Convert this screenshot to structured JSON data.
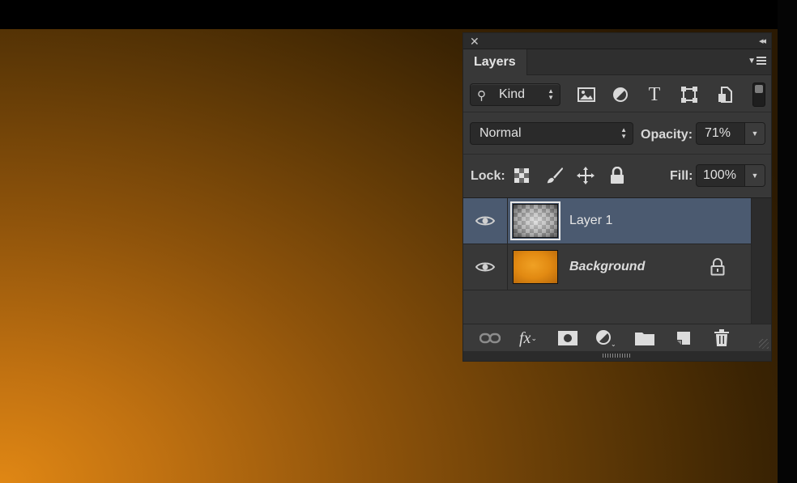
{
  "panel": {
    "close_glyph": "✕",
    "collapse_glyph": "◂◂",
    "tab_label": "Layers",
    "filter": {
      "kind_label": "Kind"
    },
    "blend_mode": "Normal",
    "opacity_label": "Opacity:",
    "opacity_value": "71%",
    "lock_label": "Lock:",
    "fill_label": "Fill:",
    "fill_value": "100%",
    "layers": [
      {
        "name": "Layer 1",
        "visible": true,
        "selected": true,
        "thumbnail": "transparent-checker"
      },
      {
        "name": "Background",
        "visible": true,
        "selected": false,
        "locked": true,
        "thumbnail": "orange"
      }
    ]
  },
  "colors": {
    "canvas_gradient_light": "#e08714",
    "canvas_gradient_dark": "#2a1902",
    "panel_bg": "#383838",
    "selected_row": "#4b5a70"
  }
}
